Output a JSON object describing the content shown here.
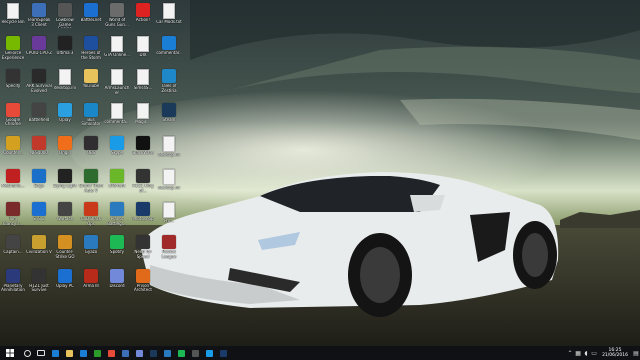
{
  "desktop": {
    "icons": [
      {
        "label": "Recycle Bin",
        "color": "#dfe6ee",
        "kind": "file"
      },
      {
        "label": "TeamSpeak 3 Client",
        "color": "#3c6fb8",
        "kind": "app"
      },
      {
        "label": "Lowbrow Game Engine",
        "color": "#555",
        "kind": "app"
      },
      {
        "label": "BattleLnet",
        "color": "#1b6fd0",
        "kind": "app"
      },
      {
        "label": "World of Guns Gun...",
        "color": "#6b6b6b",
        "kind": "app"
      },
      {
        "label": "Action!",
        "color": "#d22",
        "kind": "app"
      },
      {
        "label": "Car Mods.txt",
        "color": "#f4f4f4",
        "kind": "file"
      },
      {
        "label": "GeForce Experience",
        "color": "#76b900",
        "kind": "app"
      },
      {
        "label": "CPUID CPU-Z",
        "color": "#6a3a9a",
        "kind": "app"
      },
      {
        "label": "Ultima 3",
        "color": "#222",
        "kind": "app"
      },
      {
        "label": "Heroes of the Storm",
        "color": "#1e4f9e",
        "kind": "app"
      },
      {
        "label": "GTA Online...",
        "color": "#f4f4f4",
        "kind": "file"
      },
      {
        "label": "DIX",
        "color": "#f4f4f4",
        "kind": "file"
      },
      {
        "label": "commentar...",
        "color": "#1a7fd4",
        "kind": "app"
      },
      {
        "label": "Specify",
        "color": "#333",
        "kind": "app"
      },
      {
        "label": "ARK Survival Evolved",
        "color": "#2a2a2a",
        "kind": "app"
      },
      {
        "label": "desktop.ini",
        "color": "#f4f4f4",
        "kind": "file"
      },
      {
        "label": "YouTube",
        "color": "#f0c04a",
        "kind": "folder"
      },
      {
        "label": "ArmsLauncher",
        "color": "#f4f4f4",
        "kind": "file"
      },
      {
        "label": "Sims4S...",
        "color": "#f4f4f4",
        "kind": "file"
      },
      {
        "label": "Tales of Zestiria",
        "color": "#1e88c8",
        "kind": "app"
      },
      {
        "label": "Google Chrome",
        "color": "#e84a3a",
        "kind": "app"
      },
      {
        "label": "Battlefield",
        "color": "#444",
        "kind": "app"
      },
      {
        "label": "Uplay",
        "color": "#2ba0e0",
        "kind": "app"
      },
      {
        "label": "Bus Simulator",
        "color": "#1a88c8",
        "kind": "app"
      },
      {
        "label": "commenta...",
        "color": "#f4f4f4",
        "kind": "file"
      },
      {
        "label": "Magic...",
        "color": "#f4f4f4",
        "kind": "file"
      },
      {
        "label": "Steam",
        "color": "#1b3a5a",
        "kind": "app"
      },
      {
        "label": "Counter...",
        "color": "#d4a020",
        "kind": "app"
      },
      {
        "label": "NFS4000",
        "color": "#c0392b",
        "kind": "app"
      },
      {
        "label": "Origin",
        "color": "#f06d1a",
        "kind": "app"
      },
      {
        "label": "OBS",
        "color": "#302e31",
        "kind": "app"
      },
      {
        "label": "Skype",
        "color": "#1a9be8",
        "kind": "app"
      },
      {
        "label": "BlackWare",
        "color": "#111",
        "kind": "app"
      },
      {
        "label": "desktop.ini",
        "color": "#f4f4f4",
        "kind": "file"
      },
      {
        "label": "Mechanic...",
        "color": "#c02020",
        "kind": "app"
      },
      {
        "label": "Edge",
        "color": "#1a6fc8",
        "kind": "app"
      },
      {
        "label": "Dying Light",
        "color": "#222",
        "kind": "app"
      },
      {
        "label": "Grand Theft Auto V",
        "color": "#2e6b2e",
        "kind": "app"
      },
      {
        "label": "uTorrent",
        "color": "#6ab82a",
        "kind": "app"
      },
      {
        "label": "H1Z1 King of...",
        "color": "#333",
        "kind": "app"
      },
      {
        "label": "desktop.ini",
        "color": "#f4f4f4",
        "kind": "file"
      },
      {
        "label": "Tom Clancy's...",
        "color": "#7a2a2a",
        "kind": "app"
      },
      {
        "label": "ETS 2",
        "color": "#1a6fd0",
        "kind": "app"
      },
      {
        "label": "Warface",
        "color": "#444",
        "kind": "app"
      },
      {
        "label": "CoD Black Ops",
        "color": "#c83a1a",
        "kind": "app"
      },
      {
        "label": "Plants Battlegr...",
        "color": "#2a7abf",
        "kind": "app"
      },
      {
        "label": "Photoshop",
        "color": "#1a3a6a",
        "kind": "app"
      },
      {
        "label": "Pro...",
        "color": "#f4f4f4",
        "kind": "file"
      },
      {
        "label": "Captain...",
        "color": "#444",
        "kind": "app"
      },
      {
        "label": "Civilization V",
        "color": "#c8a030",
        "kind": "app"
      },
      {
        "label": "Counter-Strike GO",
        "color": "#d49020",
        "kind": "app"
      },
      {
        "label": "Gyazo",
        "color": "#2a7abf",
        "kind": "app"
      },
      {
        "label": "Spotify",
        "color": "#1db954",
        "kind": "app"
      },
      {
        "label": "Need for Speed",
        "color": "#333",
        "kind": "app"
      },
      {
        "label": "Rocket League",
        "color": "#a02a2a",
        "kind": "app"
      },
      {
        "label": "Planetary Annihilation",
        "color": "#2a3a7a",
        "kind": "app"
      },
      {
        "label": "H1Z1 Just Survive",
        "color": "#333",
        "kind": "app"
      },
      {
        "label": "Uplay PC",
        "color": "#1a6fd0",
        "kind": "app"
      },
      {
        "label": "Arma III",
        "color": "#b82a1a",
        "kind": "app"
      },
      {
        "label": "Discord",
        "color": "#7289da",
        "kind": "app"
      },
      {
        "label": "Prison Architect",
        "color": "#e06a1a",
        "kind": "app"
      }
    ]
  },
  "taskbar": {
    "items": [
      {
        "name": "search",
        "color": "#e0e0e0"
      },
      {
        "name": "task-view",
        "color": "#e0e0e0"
      },
      {
        "name": "edge",
        "color": "#1a7fd4"
      },
      {
        "name": "file-explorer",
        "color": "#e8c25a"
      },
      {
        "name": "store",
        "color": "#1a7fd4"
      },
      {
        "name": "xbox",
        "color": "#2a9a2a"
      },
      {
        "name": "chrome",
        "color": "#e84a3a"
      },
      {
        "name": "teamspeak",
        "color": "#3c6fb8"
      },
      {
        "name": "discord",
        "color": "#7289da"
      },
      {
        "name": "steam",
        "color": "#1b3a5a"
      },
      {
        "name": "gyazo",
        "color": "#2a7abf"
      },
      {
        "name": "spotify",
        "color": "#1db954"
      },
      {
        "name": "obs",
        "color": "#555"
      },
      {
        "name": "skype",
        "color": "#1a9be8"
      },
      {
        "name": "photoshop",
        "color": "#1a3a6a"
      }
    ],
    "clock": {
      "time": "16:25",
      "date": "21/06/2016"
    }
  }
}
